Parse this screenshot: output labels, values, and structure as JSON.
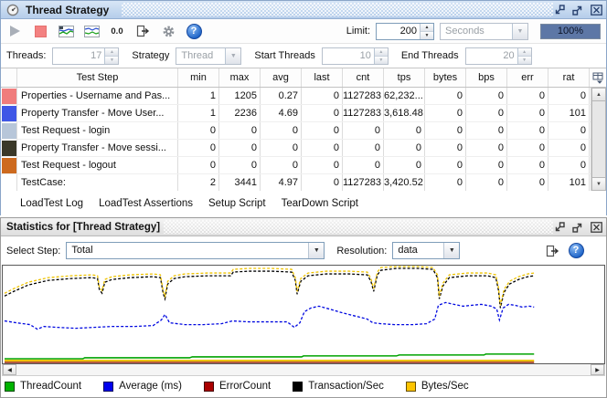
{
  "loadtest": {
    "title": "Thread Strategy",
    "toolbar": {
      "reset_label": "0.0",
      "icons": [
        "run-icon",
        "stop-icon",
        "statistics-graph-icon",
        "statistics-history-icon",
        "reset-statistics",
        "export-icon",
        "options-gear-icon",
        "help-icon"
      ]
    },
    "limit": {
      "label": "Limit:",
      "value": "200"
    },
    "time_unit": {
      "value": "Seconds"
    },
    "progress": {
      "value": "100%"
    },
    "threads": {
      "label": "Threads:",
      "value": "17"
    },
    "strategy": {
      "label": "Strategy",
      "value": "Thread"
    },
    "start_threads": {
      "label": "Start Threads",
      "value": "10"
    },
    "end_threads": {
      "label": "End Threads",
      "value": "20"
    },
    "table": {
      "columns": [
        "Test Step",
        "min",
        "max",
        "avg",
        "last",
        "cnt",
        "tps",
        "bytes",
        "bps",
        "err",
        "rat"
      ],
      "rows": [
        {
          "color": "#f07d7d",
          "step": "Properties - Username and Pas...",
          "min": "1",
          "max": "1205",
          "avg": "0.27",
          "last": "0",
          "cnt": "1127283",
          "tps": "62,232...",
          "bytes": "0",
          "bps": "0",
          "err": "0",
          "rat": "0"
        },
        {
          "color": "#3f57e6",
          "step": "Property Transfer - Move User...",
          "min": "1",
          "max": "2236",
          "avg": "4.69",
          "last": "0",
          "cnt": "1127283",
          "tps": "3,618.48",
          "bytes": "0",
          "bps": "0",
          "err": "0",
          "rat": "101"
        },
        {
          "color": "#b7c6d9",
          "step": "Test Request - login",
          "min": "0",
          "max": "0",
          "avg": "0",
          "last": "0",
          "cnt": "0",
          "tps": "0",
          "bytes": "0",
          "bps": "0",
          "err": "0",
          "rat": "0"
        },
        {
          "color": "#3a3828",
          "step": "Property Transfer - Move sessi...",
          "min": "0",
          "max": "0",
          "avg": "0",
          "last": "0",
          "cnt": "0",
          "tps": "0",
          "bytes": "0",
          "bps": "0",
          "err": "0",
          "rat": "0"
        },
        {
          "color": "#cd6a1f",
          "step": "Test Request - logout",
          "min": "0",
          "max": "0",
          "avg": "0",
          "last": "0",
          "cnt": "0",
          "tps": "0",
          "bytes": "0",
          "bps": "0",
          "err": "0",
          "rat": "0"
        },
        {
          "color": "",
          "step": "TestCase:",
          "min": "2",
          "max": "3441",
          "avg": "4.97",
          "last": "0",
          "cnt": "1127283",
          "tps": "3,420.52",
          "bytes": "0",
          "bps": "0",
          "err": "0",
          "rat": "101"
        }
      ]
    },
    "tabs": [
      "LoadTest Log",
      "LoadTest Assertions",
      "Setup Script",
      "TearDown Script"
    ]
  },
  "stats": {
    "title": "Statistics for [Thread Strategy]",
    "select_step": {
      "label": "Select Step:",
      "value": "Total"
    },
    "resolution": {
      "label": "Resolution:",
      "value": "data"
    },
    "legend": [
      {
        "label": "ThreadCount",
        "color": "#00b400"
      },
      {
        "label": "Average (ms)",
        "color": "#0000ee"
      },
      {
        "label": "ErrorCount",
        "color": "#ab0000"
      },
      {
        "label": "Transaction/Sec",
        "color": "#000000"
      },
      {
        "label": "Bytes/Sec",
        "color": "#fdc400"
      }
    ]
  },
  "chart_data": {
    "type": "line",
    "title": "Statistics for [Thread Strategy]",
    "xlabel": "",
    "ylabel": "",
    "axes_visible": false,
    "grid": false,
    "legend_position": "bottom",
    "note": "No axis ticks or scale are rendered in the source UI; each series is independently scaled. Points below are [x,y] positions inside the 660x106 plot area (y=0 is top). Data trace ends at x=583 of 660.",
    "plot_size": [
      660,
      106
    ],
    "series": [
      {
        "name": "Transaction/Sec",
        "color": "#000000",
        "dash": "3 2",
        "width": 1.3,
        "points": [
          [
            2,
            33
          ],
          [
            12,
            28
          ],
          [
            28,
            21
          ],
          [
            50,
            16
          ],
          [
            75,
            14
          ],
          [
            98,
            13
          ],
          [
            104,
            14
          ],
          [
            106,
            26
          ],
          [
            109,
            30
          ],
          [
            112,
            18
          ],
          [
            120,
            15
          ],
          [
            140,
            13
          ],
          [
            165,
            12
          ],
          [
            173,
            13
          ],
          [
            176,
            30
          ],
          [
            178,
            36
          ],
          [
            181,
            20
          ],
          [
            188,
            14
          ],
          [
            200,
            12
          ],
          [
            225,
            11
          ],
          [
            250,
            11
          ],
          [
            253,
            7
          ],
          [
            270,
            6
          ],
          [
            295,
            6
          ],
          [
            317,
            7
          ],
          [
            321,
            16
          ],
          [
            323,
            31
          ],
          [
            327,
            17
          ],
          [
            335,
            11
          ],
          [
            355,
            9
          ],
          [
            380,
            9
          ],
          [
            400,
            10
          ],
          [
            404,
            17
          ],
          [
            407,
            28
          ],
          [
            411,
            10
          ],
          [
            415,
            5
          ],
          [
            432,
            3
          ],
          [
            455,
            3
          ],
          [
            472,
            4
          ],
          [
            477,
            13
          ],
          [
            479,
            36
          ],
          [
            483,
            22
          ],
          [
            490,
            13
          ],
          [
            510,
            11
          ],
          [
            532,
            11
          ],
          [
            541,
            13
          ],
          [
            544,
            27
          ],
          [
            546,
            46
          ],
          [
            550,
            29
          ],
          [
            556,
            20
          ],
          [
            566,
            15
          ],
          [
            576,
            12
          ],
          [
            583,
            11
          ]
        ]
      },
      {
        "name": "Bytes/Sec",
        "color": "#eec200",
        "dash": "3 2",
        "width": 1.3,
        "points": [
          [
            2,
            30
          ],
          [
            12,
            25
          ],
          [
            28,
            18
          ],
          [
            50,
            13
          ],
          [
            75,
            11
          ],
          [
            98,
            10
          ],
          [
            104,
            11
          ],
          [
            106,
            23
          ],
          [
            109,
            27
          ],
          [
            112,
            15
          ],
          [
            120,
            12
          ],
          [
            140,
            10
          ],
          [
            165,
            9
          ],
          [
            173,
            10
          ],
          [
            176,
            27
          ],
          [
            178,
            33
          ],
          [
            181,
            17
          ],
          [
            188,
            11
          ],
          [
            200,
            9
          ],
          [
            225,
            8
          ],
          [
            250,
            8
          ],
          [
            253,
            4
          ],
          [
            270,
            3
          ],
          [
            295,
            3
          ],
          [
            317,
            4
          ],
          [
            321,
            13
          ],
          [
            323,
            28
          ],
          [
            327,
            14
          ],
          [
            335,
            8
          ],
          [
            355,
            6
          ],
          [
            380,
            6
          ],
          [
            400,
            7
          ],
          [
            404,
            14
          ],
          [
            407,
            25
          ],
          [
            411,
            7
          ],
          [
            415,
            2
          ],
          [
            432,
            1
          ],
          [
            455,
            1
          ],
          [
            472,
            2
          ],
          [
            477,
            10
          ],
          [
            479,
            33
          ],
          [
            483,
            19
          ],
          [
            490,
            10
          ],
          [
            510,
            8
          ],
          [
            532,
            8
          ],
          [
            541,
            10
          ],
          [
            544,
            24
          ],
          [
            546,
            43
          ],
          [
            550,
            26
          ],
          [
            556,
            17
          ],
          [
            566,
            12
          ],
          [
            576,
            9
          ],
          [
            583,
            8
          ]
        ]
      },
      {
        "name": "Average (ms)",
        "color": "#0008e0",
        "dash": "3 2",
        "width": 1.3,
        "points": [
          [
            2,
            60
          ],
          [
            15,
            62
          ],
          [
            30,
            64
          ],
          [
            38,
            69
          ],
          [
            45,
            66
          ],
          [
            60,
            67
          ],
          [
            80,
            68
          ],
          [
            100,
            67
          ],
          [
            120,
            66
          ],
          [
            145,
            66
          ],
          [
            165,
            65
          ],
          [
            174,
            59
          ],
          [
            178,
            53
          ],
          [
            183,
            62
          ],
          [
            200,
            64
          ],
          [
            220,
            64
          ],
          [
            240,
            63
          ],
          [
            252,
            60
          ],
          [
            270,
            61
          ],
          [
            290,
            61
          ],
          [
            312,
            61
          ],
          [
            320,
            67
          ],
          [
            326,
            62
          ],
          [
            331,
            50
          ],
          [
            338,
            46
          ],
          [
            347,
            44
          ],
          [
            358,
            47
          ],
          [
            372,
            51
          ],
          [
            388,
            55
          ],
          [
            400,
            58
          ],
          [
            406,
            62
          ],
          [
            415,
            63
          ],
          [
            430,
            64
          ],
          [
            450,
            64
          ],
          [
            465,
            63
          ],
          [
            474,
            58
          ],
          [
            478,
            43
          ],
          [
            486,
            40
          ],
          [
            495,
            42
          ],
          [
            505,
            44
          ],
          [
            515,
            43
          ],
          [
            525,
            42
          ],
          [
            536,
            44
          ],
          [
            542,
            47
          ],
          [
            545,
            59
          ],
          [
            549,
            46
          ],
          [
            555,
            42
          ],
          [
            562,
            43
          ],
          [
            570,
            45
          ],
          [
            578,
            44
          ],
          [
            583,
            45
          ]
        ]
      },
      {
        "name": "ThreadCount",
        "color": "#00a300",
        "dash": "",
        "width": 1.5,
        "points": [
          [
            2,
            101
          ],
          [
            88,
            101
          ],
          [
            90,
            100
          ],
          [
            205,
            100
          ],
          [
            208,
            99
          ],
          [
            328,
            99
          ],
          [
            330,
            98
          ],
          [
            432,
            98
          ],
          [
            435,
            97
          ],
          [
            528,
            97
          ],
          [
            530,
            96
          ],
          [
            583,
            96
          ]
        ]
      },
      {
        "name": "Bytes/Sec zero baseline",
        "color": "#eec200",
        "dash": "",
        "width": 2,
        "points": [
          [
            2,
            103
          ],
          [
            583,
            103
          ]
        ]
      },
      {
        "name": "ErrorCount",
        "color": "#992200",
        "dash": "",
        "width": 1.5,
        "points": [
          [
            2,
            105
          ],
          [
            583,
            105
          ]
        ]
      }
    ]
  }
}
